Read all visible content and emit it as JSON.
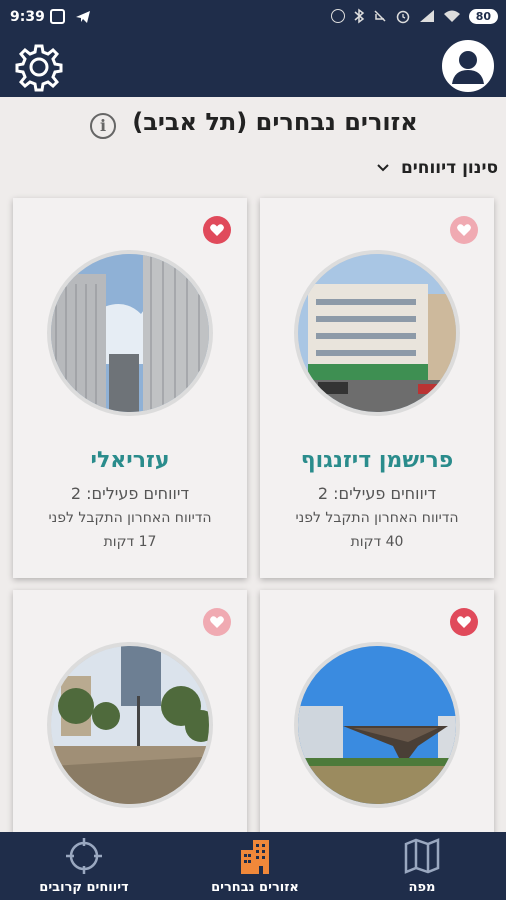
{
  "status": {
    "time": "9:39",
    "battery": "80"
  },
  "header": {
    "title": "אזורים נבחרים (תל אביב)",
    "filter_label": "סינון דיווחים"
  },
  "cards": [
    {
      "name": "פרישמן דיזנגוף",
      "active": "דיווחים פעילים: 2",
      "last": "הדיווח האחרון התקבל לפני",
      "minutes": "40 דקות",
      "favorite": "partial"
    },
    {
      "name": "עזריאלי",
      "active": "דיווחים פעילים: 2",
      "last": "הדיווח האחרון התקבל לפני",
      "minutes": "17 דקות",
      "favorite": true
    },
    {
      "favorite": true
    },
    {
      "favorite": "partial"
    }
  ],
  "nav": {
    "map": "מפה",
    "selected_areas": "אזורים נבחרים",
    "nearby_reports": "דיווחים קרובים"
  },
  "colors": {
    "primary": "#1f2d4a",
    "accent_teal": "#2a8c8c",
    "heart": "#e04a5b",
    "nav_selected": "#f0883a"
  }
}
